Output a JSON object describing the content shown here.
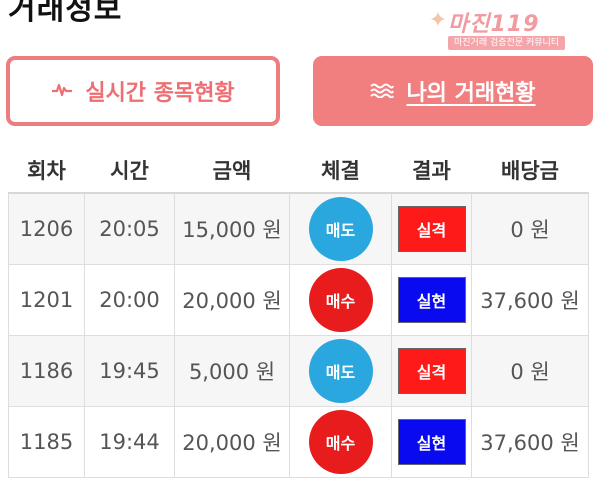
{
  "header": {
    "title": "거래정보"
  },
  "logo": {
    "name": "마진119",
    "tagline": "마진거래 검증전문 커뮤니티"
  },
  "buttons": {
    "live": {
      "icon": "pulse-icon",
      "label": "실시간 종목현황"
    },
    "mine": {
      "icon": "waves-icon",
      "label": "나의 거래현황"
    }
  },
  "table": {
    "headers": [
      "회차",
      "시간",
      "금액",
      "체결",
      "결과",
      "배당금"
    ],
    "rows": [
      {
        "round": "1206",
        "time": "20:05",
        "amount": "15,000 원",
        "trade": "매도",
        "result": "실격",
        "payout": "0 원"
      },
      {
        "round": "1201",
        "time": "20:00",
        "amount": "20,000 원",
        "trade": "매수",
        "result": "실현",
        "payout": "37,600 원"
      },
      {
        "round": "1186",
        "time": "19:45",
        "amount": "5,000 원",
        "trade": "매도",
        "result": "실격",
        "payout": "0 원"
      },
      {
        "round": "1185",
        "time": "19:44",
        "amount": "20,000 원",
        "trade": "매수",
        "result": "실현",
        "payout": "37,600 원"
      }
    ]
  },
  "colors": {
    "sell": "#2aa7de",
    "buy": "#e81c1c",
    "lose": "#ff1a1a",
    "win": "#0a0af0",
    "accent": "#f17f7f"
  }
}
